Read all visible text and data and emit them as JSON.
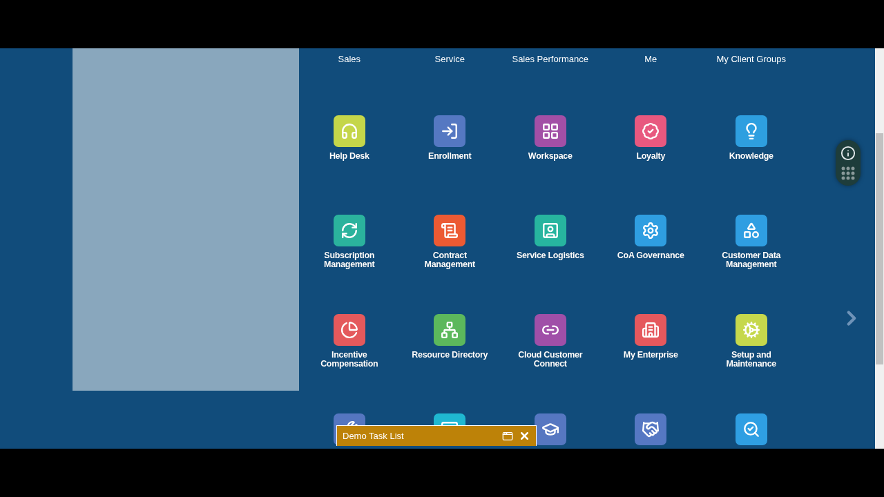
{
  "group_labels": [
    "Sales",
    "Service",
    "Sales Performance",
    "Me",
    "My Client Groups"
  ],
  "tiles": [
    {
      "label": "Help Desk",
      "color": "#c5d64a"
    },
    {
      "label": "Enrollment",
      "color": "#5578c2"
    },
    {
      "label": "Workspace",
      "color": "#a24fa6"
    },
    {
      "label": "Loyalty",
      "color": "#e8587f"
    },
    {
      "label": "Knowledge",
      "color": "#2e9fe0"
    },
    {
      "label": "Subscription Management",
      "color": "#2bb39d"
    },
    {
      "label": "Contract Management",
      "color": "#ec5a33"
    },
    {
      "label": "Service Logistics",
      "color": "#27b59f"
    },
    {
      "label": "CoA Governance",
      "color": "#2f9ee1"
    },
    {
      "label": "Customer Data Management",
      "color": "#2f9ee2"
    },
    {
      "label": "Incentive Compensation",
      "color": "#e4595c"
    },
    {
      "label": "Resource Directory",
      "color": "#5cb85c"
    },
    {
      "label": "Cloud Customer Connect",
      "color": "#a04fa8"
    },
    {
      "label": "My Enterprise",
      "color": "#e5585d"
    },
    {
      "label": "Setup and Maintenance",
      "color": "#c6d84c"
    },
    {
      "color": "#5576c0"
    },
    {
      "color": "#1fb8d1"
    },
    {
      "color": "#5677c1"
    },
    {
      "color": "#5678c3"
    },
    {
      "color": "#2f9fe3"
    }
  ],
  "task_list": {
    "title": "Demo Task List"
  }
}
